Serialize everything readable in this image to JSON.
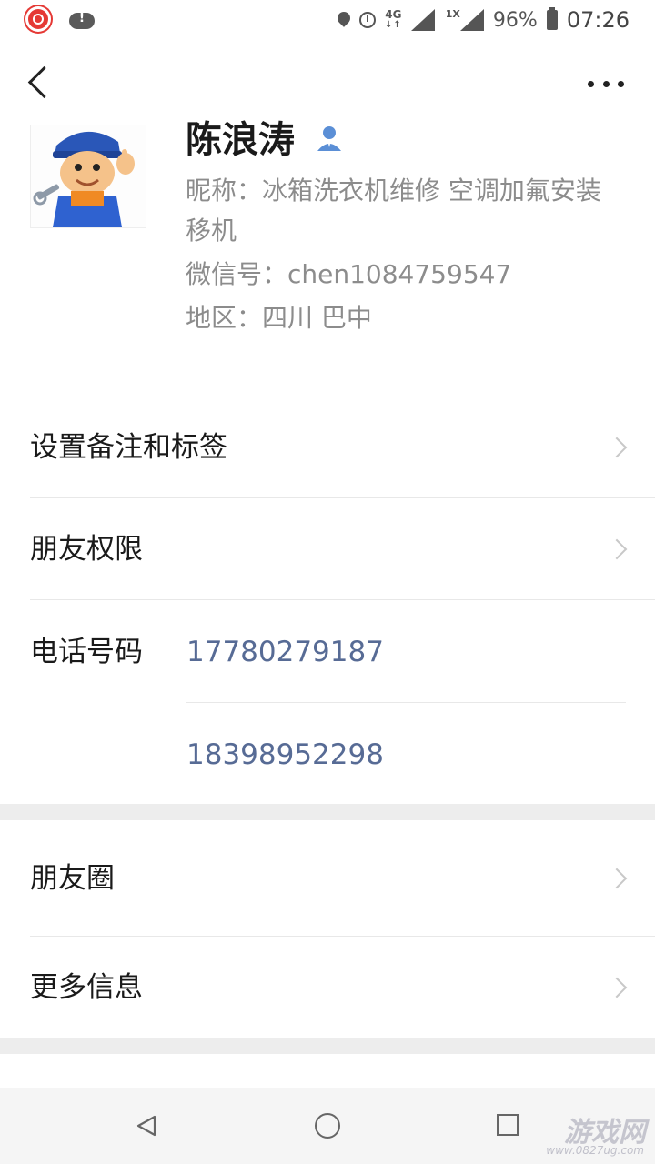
{
  "status_bar": {
    "network": "4G",
    "sim2": "1X",
    "battery": "96%",
    "time": "07:26"
  },
  "profile": {
    "name": "陈浪涛",
    "nickname": "昵称：冰箱洗衣机维修 空调加氟安装移机",
    "wechat_id": "微信号：chen1084759547",
    "region": "地区：四川  巴中"
  },
  "menu": {
    "remark": "设置备注和标签",
    "permissions": "朋友权限",
    "phone_label": "电话号码",
    "phones": [
      "17780279187",
      "18398952298"
    ],
    "moments": "朋友圈",
    "more_info": "更多信息"
  },
  "watermark": {
    "text": "游戏网",
    "url": "www.0827ug.com"
  }
}
